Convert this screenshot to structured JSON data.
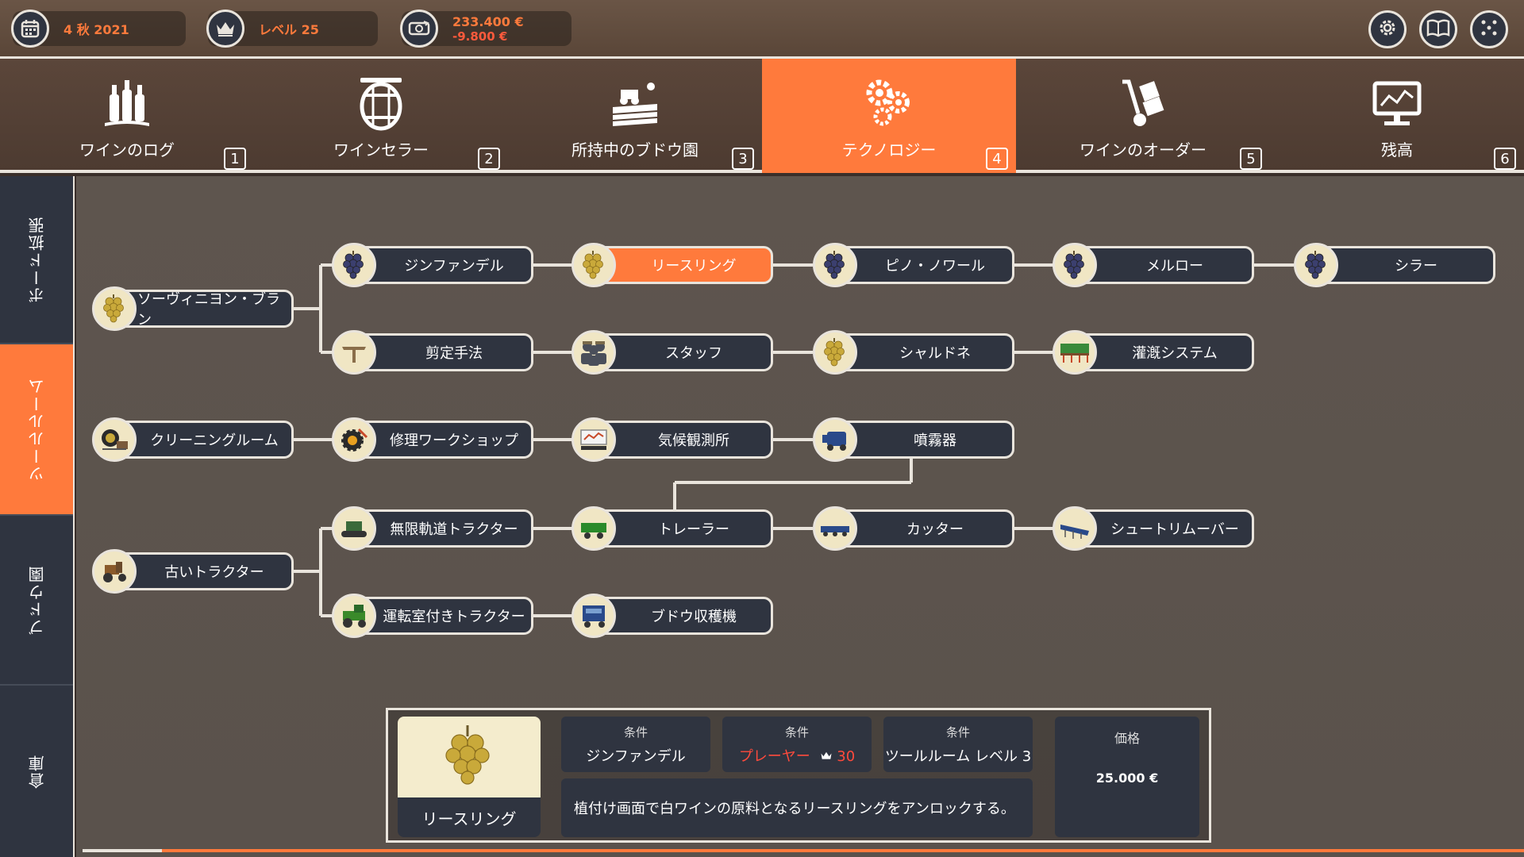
{
  "topbar": {
    "date": "4 秋 2021",
    "level": "レベル 25",
    "money": "233.400 €",
    "money_change": "-9.800 €"
  },
  "tabs": [
    {
      "label": "ワインのログ",
      "key": "1",
      "icon": "wine-bottles-icon"
    },
    {
      "label": "ワインセラー",
      "key": "2",
      "icon": "barrel-icon"
    },
    {
      "label": "所持中のブドウ園",
      "key": "3",
      "icon": "vineyard-icon"
    },
    {
      "label": "テクノロジー",
      "key": "4",
      "icon": "gears-icon"
    },
    {
      "label": "ワインのオーダー",
      "key": "5",
      "icon": "hand-truck-icon"
    },
    {
      "label": "残高",
      "key": "6",
      "icon": "monitor-chart-icon"
    }
  ],
  "active_tab": "テクノロジー",
  "side_tabs": [
    "ボード拡張",
    "ツールルーム",
    "ブドウ園",
    "倉庫"
  ],
  "active_side_tab": "ツールルーム",
  "nodes": {
    "sauvignon": "ソーヴィニヨン・ブラン",
    "zinfandel": "ジンファンデル",
    "riesling": "リースリング",
    "pinot": "ピノ・ノワール",
    "merlot": "メルロー",
    "syrah": "シラー",
    "pruning": "剪定手法",
    "staff": "スタッフ",
    "chardonnay": "シャルドネ",
    "irrigation": "灌漑システム",
    "cleaning": "クリーニングルーム",
    "repair": "修理ワークショップ",
    "weather": "気候観測所",
    "sprayer": "噴霧器",
    "old_tractor": "古いトラクター",
    "crawler": "無限軌道トラクター",
    "trailer": "トレーラー",
    "cutter": "カッター",
    "shoot": "シュートリムーバー",
    "cab_tractor": "運転室付きトラクター",
    "harvester": "ブドウ収穫機"
  },
  "selected_node": "リースリング",
  "detail": {
    "name": "リースリング",
    "req1_label": "条件",
    "req1_value": "ジンファンデル",
    "req2_label": "条件",
    "req2_value": "プレーヤー",
    "req2_level": "30",
    "req3_label": "条件",
    "req3_value": "ツールルーム レベル 3",
    "price_label": "価格",
    "price_value": "25.000 €",
    "description": "植付け画面で白ワインの原料となるリースリングをアンロックする。"
  },
  "colors": {
    "accent": "#ff7a3c",
    "panel": "#2f3440",
    "border": "#e9e4dc",
    "badge_bg": "#f0e6c4",
    "red_grape": "#3b3f6e",
    "white_grape": "#c9a93a"
  }
}
